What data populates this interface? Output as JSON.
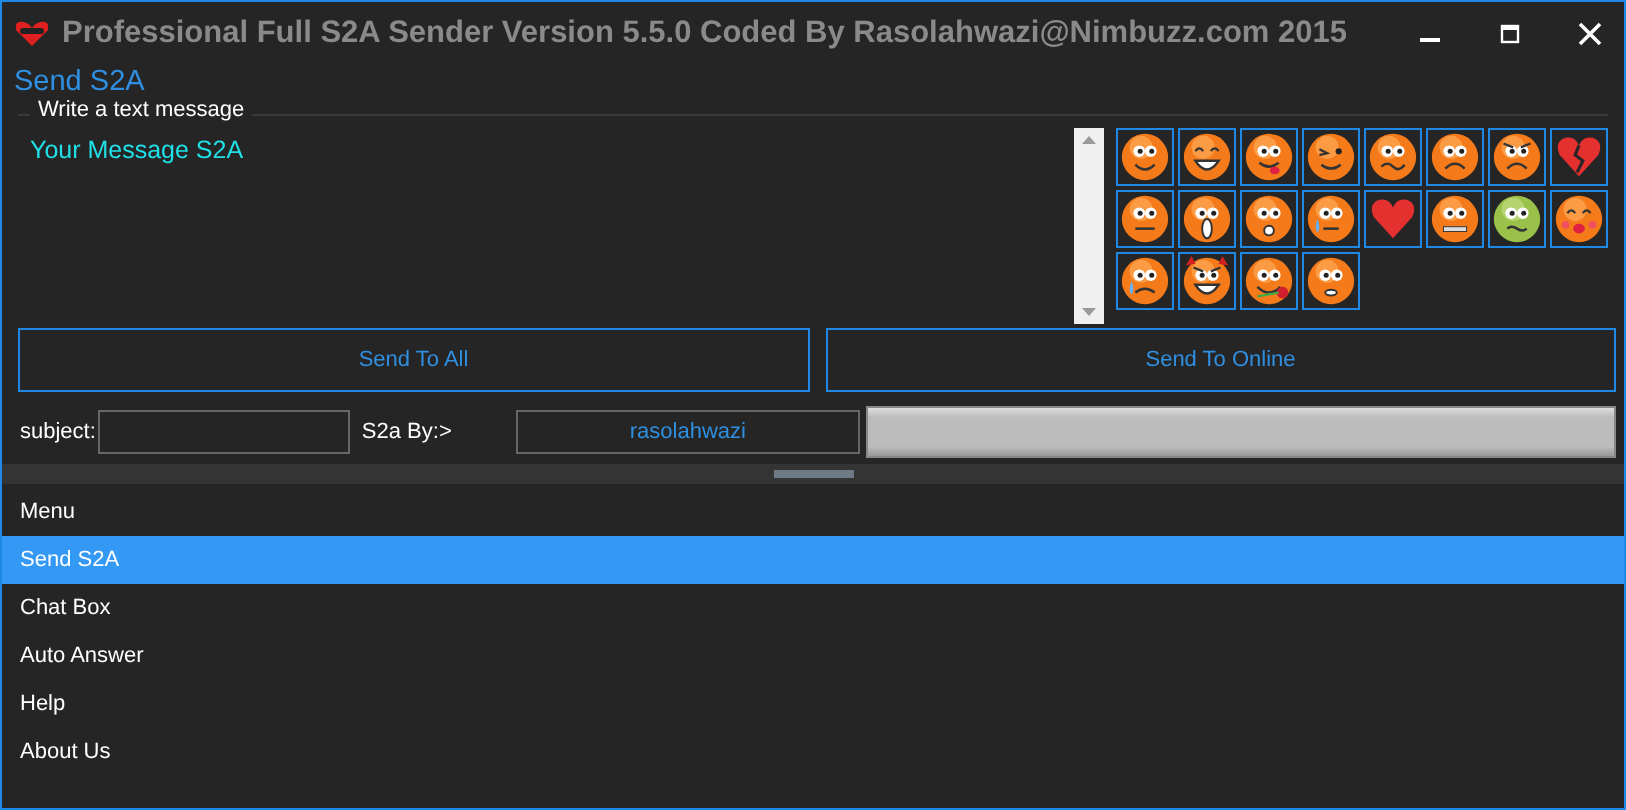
{
  "window": {
    "title": "Professional Full S2A Sender Version 5.5.0 Coded By Rasolahwazi@Nimbuzz.com 2015"
  },
  "page_title": "Send S2A",
  "message_group": {
    "label": "Write a text message",
    "value": "Your Message S2A"
  },
  "emoticons": [
    {
      "kind": "smile"
    },
    {
      "kind": "grin"
    },
    {
      "kind": "tongue"
    },
    {
      "kind": "wink"
    },
    {
      "kind": "confused"
    },
    {
      "kind": "sad"
    },
    {
      "kind": "angry"
    },
    {
      "kind": "broken-heart"
    },
    {
      "kind": "neutral"
    },
    {
      "kind": "shocked"
    },
    {
      "kind": "surprised"
    },
    {
      "kind": "sweat"
    },
    {
      "kind": "heart"
    },
    {
      "kind": "zipped"
    },
    {
      "kind": "sick"
    },
    {
      "kind": "kiss"
    },
    {
      "kind": "crying"
    },
    {
      "kind": "devil"
    },
    {
      "kind": "rose"
    },
    {
      "kind": "worried"
    }
  ],
  "buttons": [
    "Send To All",
    "Send To Online"
  ],
  "subject": {
    "label": "subject:"
  },
  "s2a_by": {
    "label": "S2a By:>",
    "value": "rasolahwazi"
  },
  "progress": {
    "level": 0
  },
  "menu": [
    {
      "label": "Menu",
      "selected": false
    },
    {
      "label": "Send S2A",
      "selected": true
    },
    {
      "label": "Chat Box",
      "selected": false
    },
    {
      "label": "Auto Answer",
      "selected": false
    },
    {
      "label": "Help",
      "selected": false
    },
    {
      "label": "About Us",
      "selected": false
    }
  ]
}
